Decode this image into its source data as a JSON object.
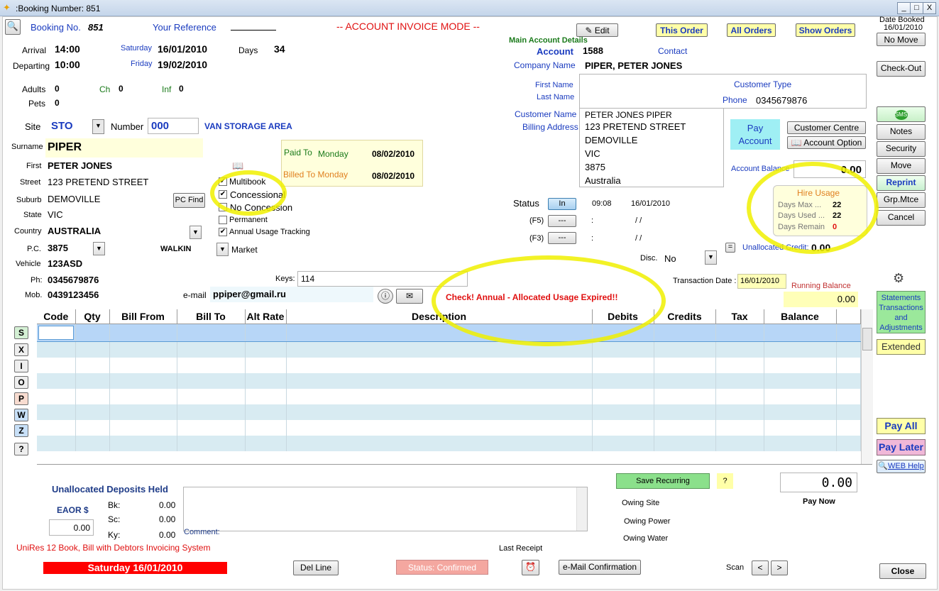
{
  "window": {
    "title": ":Booking Number: 851",
    "min": "_",
    "max": "□",
    "close": "X"
  },
  "header": {
    "booking_label": "Booking No.",
    "booking_no": "851",
    "your_reference_label": "Your Reference",
    "mode": "-- ACCOUNT INVOICE MODE --",
    "edit": "Edit",
    "this_order": "This Order",
    "all_orders": "All Orders",
    "show_orders": "Show Orders",
    "date_booked_label": "Date Booked",
    "date_booked": "16/01/2010",
    "no_move": "No Move"
  },
  "stay": {
    "arrival_label": "Arrival",
    "arrival_time": "14:00",
    "arrival_day": "Saturday",
    "arrival_date": "16/01/2010",
    "departing_label": "Departing",
    "departing_time": "10:00",
    "departing_day": "Friday",
    "departing_date": "19/02/2010",
    "days_label": "Days",
    "days": "34",
    "adults_label": "Adults",
    "adults": "0",
    "ch_label": "Ch",
    "ch": "0",
    "inf_label": "Inf",
    "inf": "0",
    "pets_label": "Pets",
    "pets": "0"
  },
  "site": {
    "site_label": "Site",
    "site": "STO",
    "number_label": "Number",
    "number": "000",
    "area": "VAN STORAGE AREA"
  },
  "guest": {
    "surname_label": "Surname",
    "surname": "PIPER",
    "first_label": "First",
    "first": "PETER JONES",
    "street_label": "Street",
    "street": "123 PRETEND STREET",
    "suburb_label": "Suburb",
    "suburb": "DEMOVILLE",
    "pc_find": "PC Find",
    "state_label": "State",
    "state": "VIC",
    "country_label": "Country",
    "country": "AUSTRALIA",
    "pc_label": "P.C.",
    "pc": "3875",
    "walkin": "WALKIN",
    "market": "Market",
    "vehicle_label": "Vehicle",
    "vehicle": "123ASD",
    "ph_label": "Ph:",
    "ph": "0345679876",
    "mob_label": "Mob.",
    "mob": "0439123456",
    "email_label": "e-mail",
    "email": "ppiper@gmail.ru",
    "keys_label": "Keys:",
    "keys": "114"
  },
  "options": {
    "multibook": "Multibook",
    "concessional": "Concessional",
    "no_concession": "No Concession",
    "permanent": "Permanent",
    "annual": "Annual Usage Tracking"
  },
  "paid": {
    "paid_to_label": "Paid To",
    "paid_to_day": "Monday",
    "paid_to_date": "08/02/2010",
    "billed_to_label": "Billed To Monday",
    "billed_to_date": "08/02/2010"
  },
  "account": {
    "main_title": "Main Account Details",
    "account_label": "Account",
    "account": "1588",
    "contact_label": "Contact",
    "company_label": "Company Name",
    "company": "PIPER, PETER JONES",
    "first_name_label": "First Name",
    "last_name_label": "Last Name",
    "customer_type_label": "Customer Type",
    "phone_label": "Phone",
    "phone": "0345679876",
    "customer_name_label": "Customer Name",
    "billing_label": "Billing Address",
    "billing_lines": [
      "PETER JONES PIPER",
      "123 PRETEND STREET",
      "DEMOVILLE",
      "VIC",
      "3875",
      "Australia"
    ],
    "pay_account": "Pay Account",
    "customer_centre": "Customer Centre",
    "account_option": "Account Option",
    "balance_label": "Account Balance",
    "balance": "0.00"
  },
  "hire": {
    "title": "Hire Usage",
    "max_label": "Days Max ...",
    "max": "22",
    "used_label": "Days Used ...",
    "used": "22",
    "remain_label": "Days Remain",
    "remain": "0"
  },
  "status": {
    "label": "Status",
    "in_btn": "In",
    "time": "09:08",
    "date": "16/01/2010",
    "f5": "(F5)",
    "f3": "(F3)",
    "dash_btn": "---",
    "colon": ":",
    "blank_date": "/ /",
    "disc_label": "Disc.",
    "disc": "No",
    "unalloc_label": "Unallocated Credit:",
    "unalloc": "0.00",
    "txn_label": "Transaction Date :",
    "txn_date": "16/01/2010",
    "running_label": "Running Balance",
    "running": "0.00",
    "warning": "Check! Annual - Allocated Usage Expired!!"
  },
  "grid": {
    "columns": [
      "Code",
      "Qty",
      "Bill From",
      "Bill To",
      "Alt Rate",
      "Description",
      "Debits",
      "Credits",
      "Tax",
      "Balance"
    ]
  },
  "side_buttons": [
    "S",
    "X",
    "I",
    "O",
    "P",
    "W",
    "Z",
    "?"
  ],
  "right_buttons": {
    "checkout": "Check-Out",
    "sms": "SMS",
    "notes": "Notes",
    "security": "Security",
    "move": "Move",
    "reprint": "Reprint",
    "grp": "Grp.Mtce",
    "cancel": "Cancel",
    "statements": "Statements Transactions and Adjustments",
    "extended": "Extended",
    "pay_all": "Pay All",
    "pay_later": "Pay Later",
    "web_help": "WEB Help"
  },
  "footer": {
    "deposits_title": "Unallocated Deposits Held",
    "eaor_label": "EAOR $",
    "eaor": "0.00",
    "bk_label": "Bk:",
    "bk": "0.00",
    "sc_label": "Sc:",
    "sc": "0.00",
    "ky_label": "Ky:",
    "ky": "0.00",
    "comment_label": "Comment:",
    "unires": "UniRes 12 Book, Bill with Debtors Invoicing System",
    "date_bar": "Saturday 16/01/2010",
    "del_line": "Del Line",
    "status_confirmed": "Status: Confirmed",
    "email_conf": "e-Mail Confirmation",
    "last_receipt": "Last Receipt",
    "scan_label": "Scan",
    "prev": "<",
    "next": ">",
    "close": "Close",
    "save_recurring": "Save Recurring",
    "q": "?",
    "pay_now_amount": "0.00",
    "pay_now": "Pay Now",
    "owing_site": "Owing Site",
    "owing_power": "Owing Power",
    "owing_water": "Owing Water"
  }
}
